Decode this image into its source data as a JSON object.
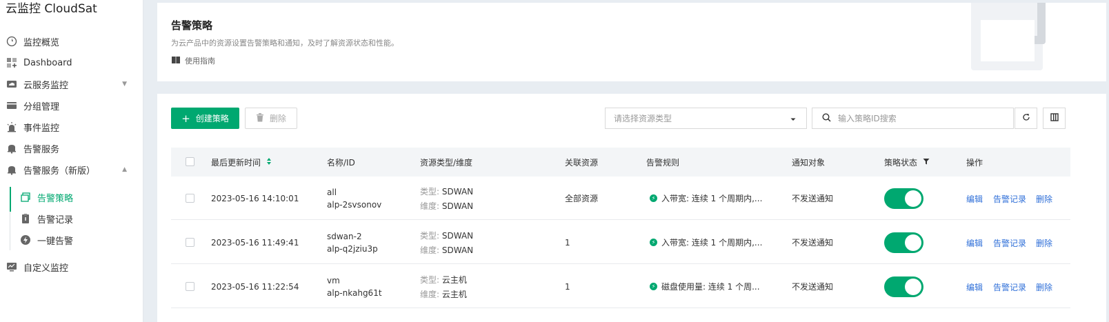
{
  "sidebar": {
    "brand": "云监控 CloudSat",
    "items": [
      {
        "label": "监控概览"
      },
      {
        "label": "Dashboard"
      },
      {
        "label": "云服务监控"
      },
      {
        "label": "分组管理"
      },
      {
        "label": "事件监控"
      },
      {
        "label": "告警服务"
      },
      {
        "label": "告警服务（新版）"
      },
      {
        "label": "自定义监控"
      }
    ],
    "sub_items": [
      {
        "label": "告警策略"
      },
      {
        "label": "告警记录"
      },
      {
        "label": "一键告警"
      }
    ]
  },
  "header": {
    "title": "告警策略",
    "desc": "为云产品中的资源设置告警策略和通知，及时了解资源状态和性能。",
    "guide": "使用指南"
  },
  "toolbar": {
    "create_label": "创建策略",
    "delete_label": "删除",
    "resource_placeholder": "请选择资源类型",
    "search_placeholder": "输入策略ID搜索"
  },
  "table": {
    "headers": {
      "time": "最后更新时间",
      "name": "名称/ID",
      "resource": "资源类型/维度",
      "related": "关联资源",
      "rule": "告警规则",
      "notify": "通知对象",
      "status": "策略状态",
      "ops": "操作"
    },
    "type_prefix": "类型:",
    "dim_prefix": "维度:",
    "rows": [
      {
        "time": "2023-05-16 14:10:01",
        "name": "all",
        "id": "alp-2svsonov",
        "type": "SDWAN",
        "dim": "SDWAN",
        "related": "全部资源",
        "rule": "入带宽: 连续 1 个周期内,...",
        "notify": "不发送通知",
        "enabled": true,
        "edit": "编辑",
        "record": "告警记录",
        "del": "删除"
      },
      {
        "time": "2023-05-16 11:49:41",
        "name": "sdwan-2",
        "id": "alp-q2jziu3p",
        "type": "SDWAN",
        "dim": "SDWAN",
        "related": "1",
        "rule": "入带宽: 连续 1 个周期内,...",
        "notify": "不发送通知",
        "enabled": true,
        "edit": "编辑",
        "record": "告警记录",
        "del": "删除"
      },
      {
        "time": "2023-05-16 11:22:54",
        "name": "vm",
        "id": "alp-nkahg61t",
        "type": "云主机",
        "dim": "云主机",
        "related": "1",
        "rule": "磁盘使用量: 连续 1 个周...",
        "notify": "不发送通知",
        "enabled": true,
        "edit": "编辑",
        "record": "告警记录",
        "del": "删除"
      }
    ]
  },
  "colors": {
    "accent": "#00a870",
    "link": "#2f6fd8"
  }
}
